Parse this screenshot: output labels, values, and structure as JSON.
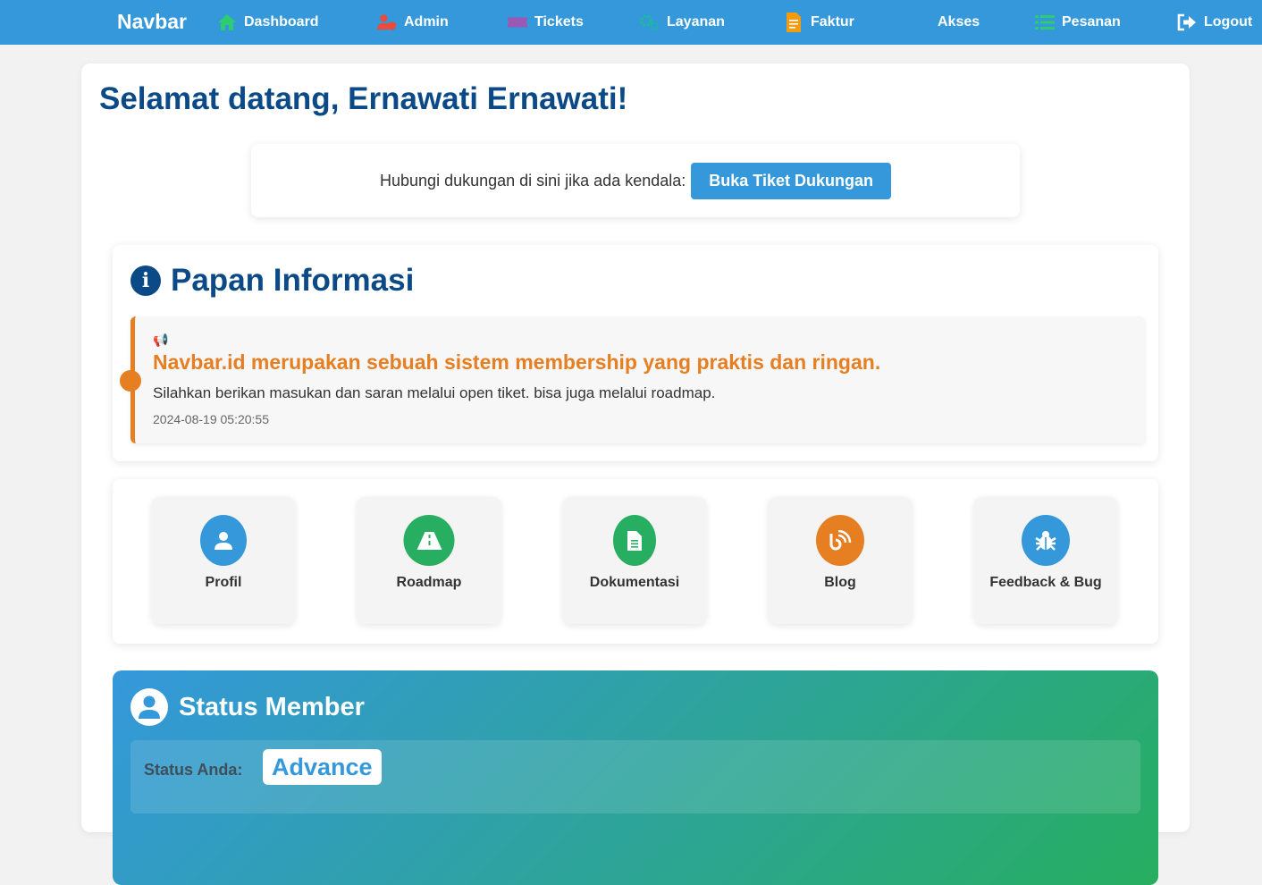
{
  "nav": {
    "brand": "Navbar",
    "items": [
      {
        "label": "Dashboard",
        "icon": "home-icon",
        "color": "#2ecc71"
      },
      {
        "label": "Admin",
        "icon": "user-shield-icon",
        "color": "#e74c3c"
      },
      {
        "label": "Tickets",
        "icon": "ticket-icon",
        "color": "#9b59b6"
      },
      {
        "label": "Layanan",
        "icon": "cogs-icon",
        "color": "#1abc9c"
      },
      {
        "label": "Faktur",
        "icon": "invoice-icon",
        "color": "#f39c12"
      },
      {
        "label": "Akses",
        "icon": "key-icon",
        "color": "#3498db"
      },
      {
        "label": "Pesanan",
        "icon": "list-icon",
        "color": "#2ecc71"
      },
      {
        "label": "Logout",
        "icon": "logout-icon",
        "color": "#ffffff"
      }
    ]
  },
  "welcome": "Selamat datang, Ernawati Ernawati!",
  "support": {
    "text": "Hubungi dukungan di sini jika ada kendala:",
    "button": "Buka Tiket Dukungan"
  },
  "info_board": {
    "title": "Papan Informasi",
    "announcement": {
      "title": "Navbar.id merupakan sebuah sistem membership yang praktis dan ringan.",
      "body": "Silahkan berikan masukan dan saran melalui open tiket. bisa juga melalui roadmap.",
      "timestamp": "2024-08-19 05:20:55"
    }
  },
  "quick_links": [
    {
      "label": "Profil",
      "icon": "user-icon",
      "color": "#3498db"
    },
    {
      "label": "Roadmap",
      "icon": "road-icon",
      "color": "#27ae60"
    },
    {
      "label": "Dokumentasi",
      "icon": "document-icon",
      "color": "#2ecc71"
    },
    {
      "label": "Blog",
      "icon": "blog-icon",
      "color": "#e67e22"
    },
    {
      "label": "Feedback & Bug",
      "icon": "bug-icon",
      "color": "#3498db"
    }
  ],
  "status": {
    "title": "Status Member",
    "label": "Status Anda:",
    "value": "Advance"
  }
}
